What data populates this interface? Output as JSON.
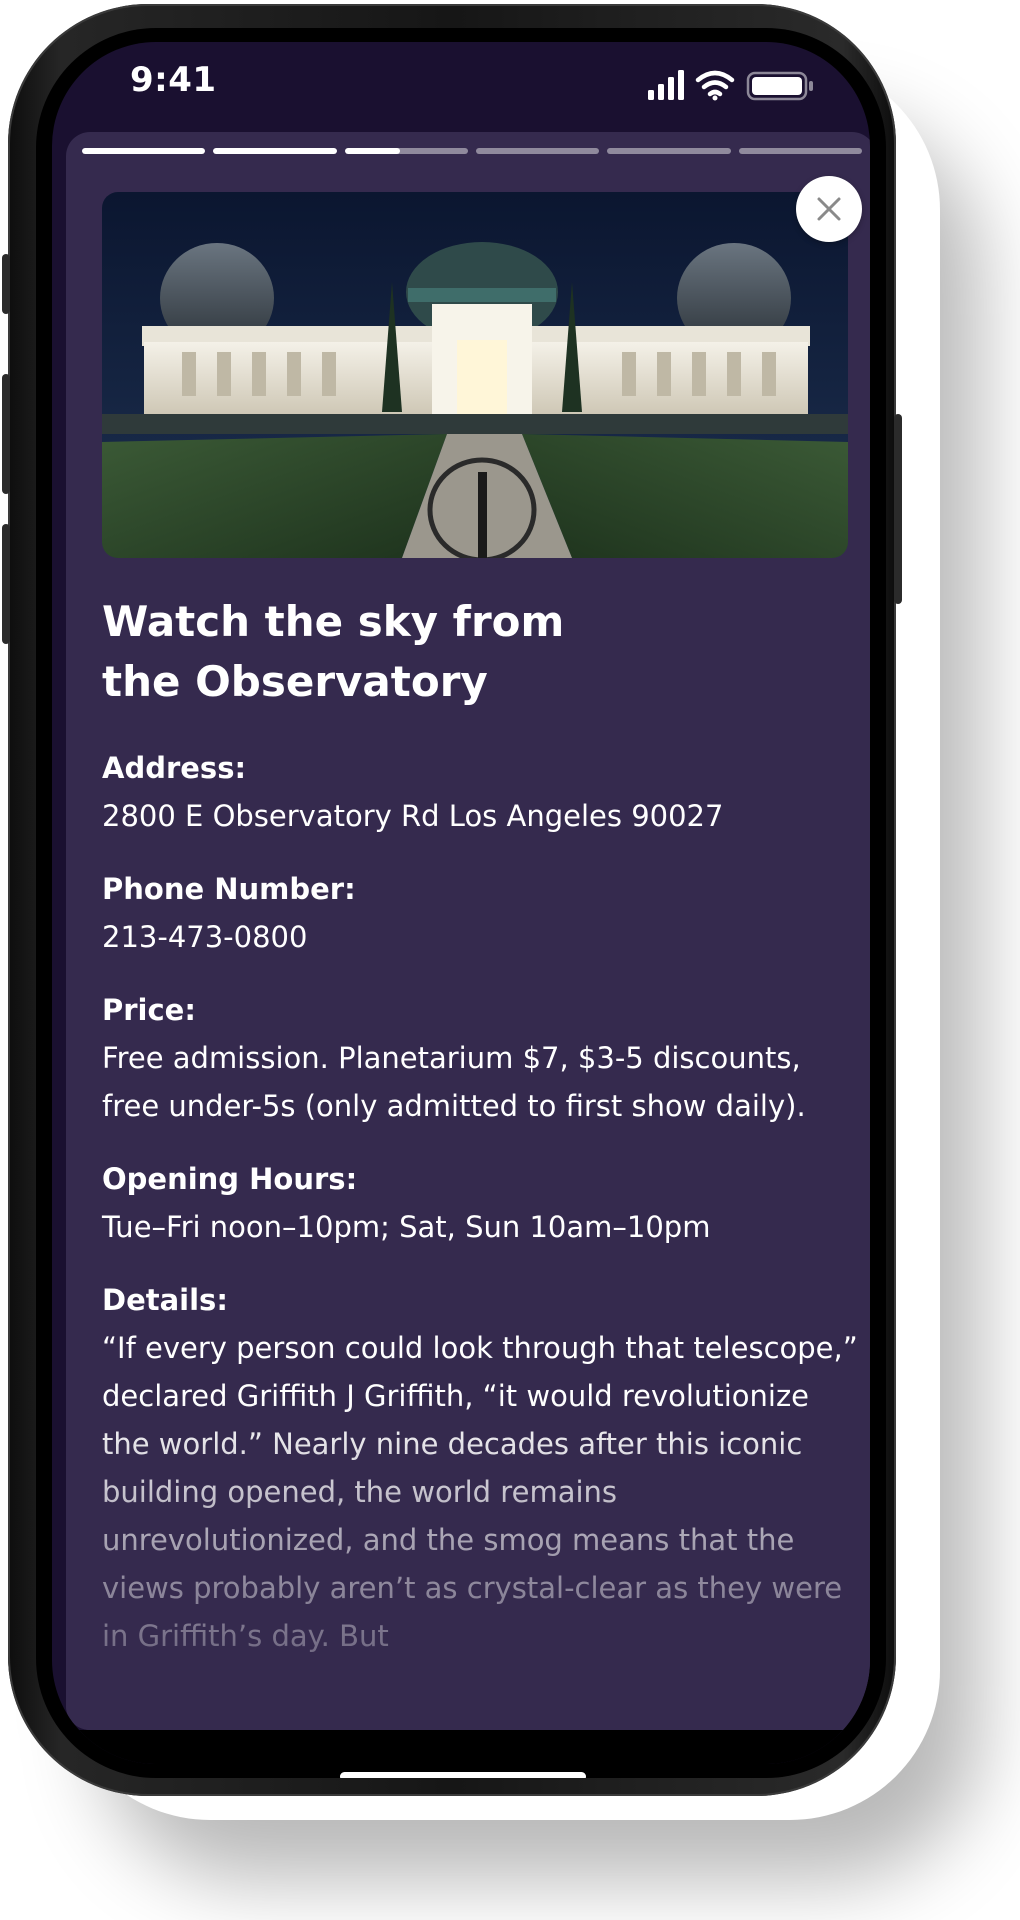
{
  "status_bar": {
    "time": "9:41",
    "icons": [
      "cellular-signal-icon",
      "wifi-icon",
      "battery-icon"
    ]
  },
  "story": {
    "segments": [
      1,
      1,
      0.45,
      0,
      0,
      0
    ],
    "image_alt": "Griffith Observatory at night",
    "close_icon": "close-icon",
    "title": "Watch the sky from the Observatory",
    "title_lines": [
      "Watch the sky from",
      "the Observatory"
    ],
    "address_label": "Address:",
    "address": "2800 E Observatory Rd Los Angeles 90027",
    "phone_label": "Phone Number:",
    "phone": "213-473-0800",
    "price_label": "Price:",
    "price": "Free admission. Planetarium $7, $3-5 discounts, free under-5s (only admitted to first show daily).",
    "hours_label": "Opening Hours:",
    "hours": "Tue–Fri noon–10pm; Sat, Sun 10am–10pm",
    "details_label": "Details:",
    "details": "“If every person could look through that telescope,” declared Griffith J Griffith, “it would revolutionize the world.” Nearly nine decades after this iconic building opened, the world remains unrevolutionized, and the smog means that the views probably aren’t as crystal-clear as they were in Griffith’s day. But"
  },
  "colors": {
    "card_background": "#352a4e",
    "status_background": "#1a1030",
    "text": "#ffffff"
  }
}
